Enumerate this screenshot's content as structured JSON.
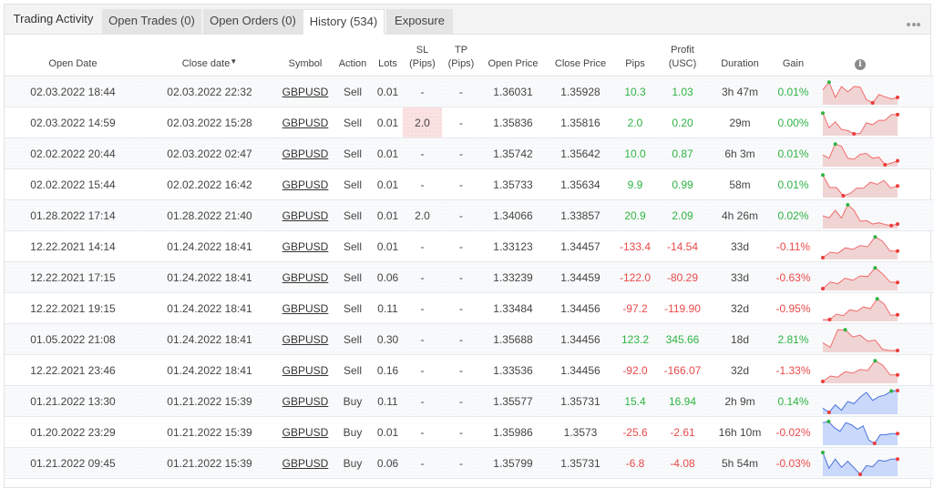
{
  "tabs": {
    "title": "Trading Activity",
    "items": [
      {
        "label": "Open Trades (0)",
        "active": false
      },
      {
        "label": "Open Orders (0)",
        "active": false
      },
      {
        "label": "History (534)",
        "active": true
      },
      {
        "label": "Exposure",
        "active": false
      }
    ],
    "more_icon": "ellipsis-icon"
  },
  "columns": {
    "open_date": "Open Date",
    "close_date": "Close date",
    "close_date_sort": "▼",
    "symbol": "Symbol",
    "action": "Action",
    "lots": "Lots",
    "sl_1": "SL",
    "sl_2": "(Pips)",
    "tp_1": "TP",
    "tp_2": "(Pips)",
    "open_price": "Open Price",
    "close_price": "Close Price",
    "pips": "Pips",
    "profit_1": "Profit",
    "profit_2": "(USC)",
    "duration": "Duration",
    "gain": "Gain",
    "chart_info_icon": "i"
  },
  "colors": {
    "positive": "#2fb344",
    "negative": "#e84a4a",
    "sell_line": "#f26b6b",
    "sell_fill": "#f0d4d4",
    "buy_line": "#4a72d9",
    "buy_fill": "#c9d8fb",
    "max_marker": "#2fb344",
    "min_marker": "#ee3b3b"
  },
  "rows": [
    {
      "open_date": "02.03.2022 18:44",
      "close_date": "02.03.2022 22:32",
      "symbol": "GBPUSD",
      "action": "Sell",
      "lots": "0.01",
      "sl": "-",
      "tp": "-",
      "open_price": "1.36031",
      "close_price": "1.35928",
      "pips": "10.3",
      "profit": "1.03",
      "duration": "3h 47m",
      "gain": "0.01%",
      "positive": true,
      "sl_highlight": false,
      "spark": [
        0.6,
        0.95,
        0.25,
        0.75,
        0.5,
        0.75,
        0.72,
        0.15,
        0.0,
        0.38,
        0.28,
        0.18,
        0.25
      ],
      "max_idx": 1,
      "min_idx": 8
    },
    {
      "open_date": "02.03.2022 14:59",
      "close_date": "02.03.2022 15:28",
      "symbol": "GBPUSD",
      "action": "Sell",
      "lots": "0.01",
      "sl": "2.0",
      "tp": "-",
      "open_price": "1.35836",
      "close_price": "1.35816",
      "pips": "2.0",
      "profit": "0.20",
      "duration": "29m",
      "gain": "0.00%",
      "positive": true,
      "sl_highlight": true,
      "spark": [
        0.95,
        0.28,
        0.55,
        0.2,
        0.15,
        0.0,
        0.02,
        0.5,
        0.42,
        0.62,
        0.62,
        0.88,
        0.88
      ],
      "max_idx": 0,
      "min_idx": 5
    },
    {
      "open_date": "02.02.2022 20:44",
      "close_date": "02.03.2022 02:47",
      "symbol": "GBPUSD",
      "action": "Sell",
      "lots": "0.01",
      "sl": "-",
      "tp": "-",
      "open_price": "1.35742",
      "close_price": "1.35642",
      "pips": "10.0",
      "profit": "0.87",
      "duration": "6h 3m",
      "gain": "0.01%",
      "positive": true,
      "sl_highlight": false,
      "spark": [
        0.45,
        0.3,
        0.95,
        0.85,
        0.3,
        0.25,
        0.48,
        0.52,
        0.3,
        0.35,
        0.0,
        0.08,
        0.18
      ],
      "max_idx": 2,
      "min_idx": 10
    },
    {
      "open_date": "02.02.2022 15:44",
      "close_date": "02.02.2022 16:42",
      "symbol": "GBPUSD",
      "action": "Sell",
      "lots": "0.01",
      "sl": "-",
      "tp": "-",
      "open_price": "1.35733",
      "close_price": "1.35634",
      "pips": "9.9",
      "profit": "0.99",
      "duration": "58m",
      "gain": "0.01%",
      "positive": true,
      "sl_highlight": false,
      "spark": [
        0.95,
        0.38,
        0.38,
        0.0,
        0.1,
        0.35,
        0.35,
        0.62,
        0.52,
        0.7,
        0.35,
        0.45
      ],
      "max_idx": 0,
      "min_idx": 3
    },
    {
      "open_date": "01.28.2022 17:14",
      "close_date": "01.28.2022 21:40",
      "symbol": "GBPUSD",
      "action": "Sell",
      "lots": "0.01",
      "sl": "2.0",
      "tp": "-",
      "open_price": "1.34066",
      "close_price": "1.33857",
      "pips": "20.9",
      "profit": "2.09",
      "duration": "4h 26m",
      "gain": "0.02%",
      "positive": true,
      "sl_highlight": false,
      "spark": [
        0.5,
        0.4,
        0.75,
        0.4,
        1.0,
        0.75,
        0.25,
        0.28,
        0.12,
        0.18,
        0.1,
        0.05,
        0.12
      ],
      "max_idx": 4,
      "min_idx": 11
    },
    {
      "open_date": "12.22.2021 14:14",
      "close_date": "01.24.2022 18:41",
      "symbol": "GBPUSD",
      "action": "Sell",
      "lots": "0.01",
      "sl": "-",
      "tp": "-",
      "open_price": "1.33123",
      "close_price": "1.34457",
      "pips": "-133.4",
      "profit": "-14.54",
      "duration": "33d",
      "gain": "-0.11%",
      "positive": false,
      "sl_highlight": false,
      "spark": [
        0.0,
        0.25,
        0.2,
        0.45,
        0.38,
        0.55,
        0.5,
        0.95,
        0.75,
        0.3,
        0.3
      ],
      "max_idx": 7,
      "min_idx": 0
    },
    {
      "open_date": "12.22.2021 17:15",
      "close_date": "01.24.2022 18:41",
      "symbol": "GBPUSD",
      "action": "Sell",
      "lots": "0.06",
      "sl": "-",
      "tp": "-",
      "open_price": "1.33239",
      "close_price": "1.34459",
      "pips": "-122.0",
      "profit": "-80.29",
      "duration": "33d",
      "gain": "-0.63%",
      "positive": false,
      "sl_highlight": false,
      "spark": [
        0.0,
        0.3,
        0.22,
        0.48,
        0.38,
        0.58,
        0.55,
        0.95,
        0.68,
        0.3,
        0.28
      ],
      "max_idx": 7,
      "min_idx": 0
    },
    {
      "open_date": "12.22.2021 19:15",
      "close_date": "01.24.2022 18:41",
      "symbol": "GBPUSD",
      "action": "Sell",
      "lots": "0.11",
      "sl": "-",
      "tp": "-",
      "open_price": "1.33484",
      "close_price": "1.34456",
      "pips": "-97.2",
      "profit": "-119.90",
      "duration": "32d",
      "gain": "-0.95%",
      "positive": false,
      "sl_highlight": false,
      "spark": [
        0.0,
        0.0,
        0.25,
        0.18,
        0.45,
        0.38,
        0.58,
        0.5,
        0.95,
        0.72,
        0.2,
        0.22
      ],
      "max_idx": 8,
      "min_idx": 1
    },
    {
      "open_date": "01.05.2022 21:08",
      "close_date": "01.24.2022 18:41",
      "symbol": "GBPUSD",
      "action": "Sell",
      "lots": "0.30",
      "sl": "-",
      "tp": "-",
      "open_price": "1.35688",
      "close_price": "1.34456",
      "pips": "123.2",
      "profit": "345.66",
      "duration": "18d",
      "gain": "2.81%",
      "positive": true,
      "sl_highlight": false,
      "spark": [
        0.35,
        0.15,
        0.95,
        0.95,
        0.62,
        0.7,
        0.42,
        0.48,
        0.05,
        0.0,
        0.0
      ],
      "max_idx": 3,
      "min_idx": 10
    },
    {
      "open_date": "12.22.2021 23:46",
      "close_date": "01.24.2022 18:41",
      "symbol": "GBPUSD",
      "action": "Sell",
      "lots": "0.16",
      "sl": "-",
      "tp": "-",
      "open_price": "1.33536",
      "close_price": "1.34456",
      "pips": "-92.0",
      "profit": "-166.07",
      "duration": "32d",
      "gain": "-1.33%",
      "positive": false,
      "sl_highlight": false,
      "spark": [
        0.0,
        0.25,
        0.2,
        0.45,
        0.38,
        0.55,
        0.5,
        0.95,
        0.75,
        0.3,
        0.3
      ],
      "max_idx": 7,
      "min_idx": 0
    },
    {
      "open_date": "01.21.2022 13:30",
      "close_date": "01.21.2022 15:39",
      "symbol": "GBPUSD",
      "action": "Buy",
      "lots": "0.11",
      "sl": "-",
      "tp": "-",
      "open_price": "1.35577",
      "close_price": "1.35731",
      "pips": "15.4",
      "profit": "16.94",
      "duration": "2h 9m",
      "gain": "0.14%",
      "positive": true,
      "sl_highlight": false,
      "spark": [
        0.2,
        0.0,
        0.35,
        0.1,
        0.5,
        0.4,
        0.7,
        0.92,
        0.55,
        0.72,
        0.8,
        0.98,
        1.0
      ],
      "max_idx": 11,
      "min_idx": 1
    },
    {
      "open_date": "01.20.2022 23:29",
      "close_date": "01.21.2022 15:39",
      "symbol": "GBPUSD",
      "action": "Buy",
      "lots": "0.01",
      "sl": "-",
      "tp": "-",
      "open_price": "1.35986",
      "close_price": "1.3573",
      "pips": "-25.6",
      "profit": "-2.61",
      "duration": "16h 10m",
      "gain": "-0.02%",
      "positive": false,
      "sl_highlight": false,
      "spark": [
        0.95,
        1.0,
        0.72,
        0.55,
        0.95,
        0.85,
        0.65,
        0.8,
        0.15,
        0.0,
        0.4,
        0.4,
        0.45,
        0.45
      ],
      "max_idx": 1,
      "min_idx": 9
    },
    {
      "open_date": "01.21.2022 09:45",
      "close_date": "01.21.2022 15:39",
      "symbol": "GBPUSD",
      "action": "Buy",
      "lots": "0.06",
      "sl": "-",
      "tp": "-",
      "open_price": "1.35799",
      "close_price": "1.35731",
      "pips": "-6.8",
      "profit": "-4.08",
      "duration": "5h 54m",
      "gain": "-0.03%",
      "positive": false,
      "sl_highlight": false,
      "spark": [
        1.0,
        0.28,
        0.7,
        0.32,
        0.6,
        0.3,
        0.0,
        0.4,
        0.35,
        0.65,
        0.6,
        0.7,
        0.7
      ],
      "max_idx": 0,
      "min_idx": 6
    }
  ]
}
